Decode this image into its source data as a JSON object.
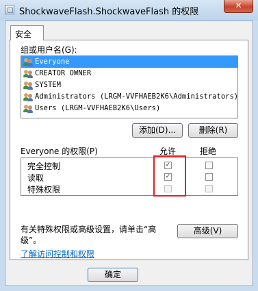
{
  "window": {
    "title": "ShockwaveFlash.ShockwaveFlash 的权限",
    "close_glyph": "✕"
  },
  "tabs": [
    {
      "label": "安全"
    }
  ],
  "groups": {
    "label": "组或用户名(G):",
    "items": [
      {
        "name": "Everyone",
        "selected": true
      },
      {
        "name": "CREATOR OWNER",
        "selected": false
      },
      {
        "name": "SYSTEM",
        "selected": false
      },
      {
        "name": "Administrators (LRGM-VVFHAEB2K6\\Administrators)",
        "selected": false
      },
      {
        "name": "Users (LRGM-VVFHAEB2K6\\Users)",
        "selected": false
      }
    ]
  },
  "buttons": {
    "add": "添加(D)...",
    "remove": "删除(R)",
    "advanced": "高级(V)",
    "ok": "确定"
  },
  "permissions": {
    "label": "Everyone 的权限(P)",
    "allow_header": "允许",
    "deny_header": "拒绝",
    "rows": [
      {
        "name": "完全控制",
        "allow": true,
        "deny": false,
        "disabled": false
      },
      {
        "name": "读取",
        "allow": true,
        "deny": false,
        "disabled": false
      },
      {
        "name": "特殊权限",
        "allow": false,
        "deny": false,
        "disabled": true
      }
    ]
  },
  "advanced_note": "有关特殊权限或高级设置，请单击“高级”。",
  "advanced_note_line1": "有关特殊权限或高级设置，请单击“高",
  "advanced_note_line2": "级”。",
  "link": "了解访问控制和权限",
  "colors": {
    "selection": "#3399ff",
    "highlight_box": "#e02020",
    "link": "#0066cc",
    "close_button": "#c7452a"
  },
  "icons": {
    "app": "window-icon",
    "user": "user-group-icon",
    "check": "checkmark"
  }
}
